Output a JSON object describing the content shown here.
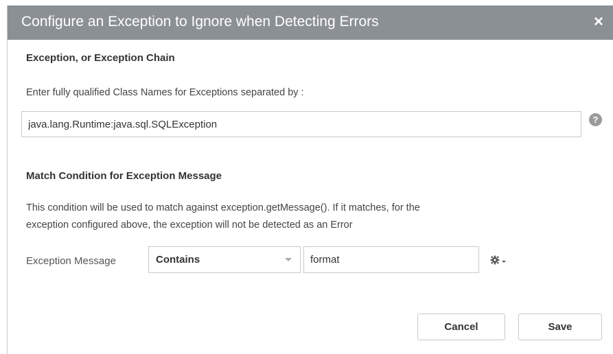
{
  "dialog": {
    "title": "Configure an Exception to Ignore when Detecting Errors",
    "close_icon": "×"
  },
  "exception_section": {
    "heading": "Exception, or Exception Chain",
    "instructions": "Enter fully qualified Class Names for Exceptions separated by :",
    "chain_value": "java.lang.Runtime:java.sql.SQLException",
    "help_icon": "?"
  },
  "match_section": {
    "heading": "Match Condition for Exception Message",
    "description_line1": "This condition will be used to match against exception.getMessage(). If it matches, for the",
    "description_line2": "exception configured above, the exception will not be detected as an Error",
    "field_label": "Exception Message",
    "condition_selected": "Contains",
    "message_value": "format"
  },
  "footer": {
    "cancel_label": "Cancel",
    "save_label": "Save"
  },
  "colors": {
    "titlebar": "#8b9095",
    "title_text": "#ffffff",
    "border": "#c8c8c8"
  },
  "icons": {
    "close": "close-icon",
    "help": "help-icon",
    "settings": "gear-icon",
    "dropdown": "chevron-down-icon"
  }
}
